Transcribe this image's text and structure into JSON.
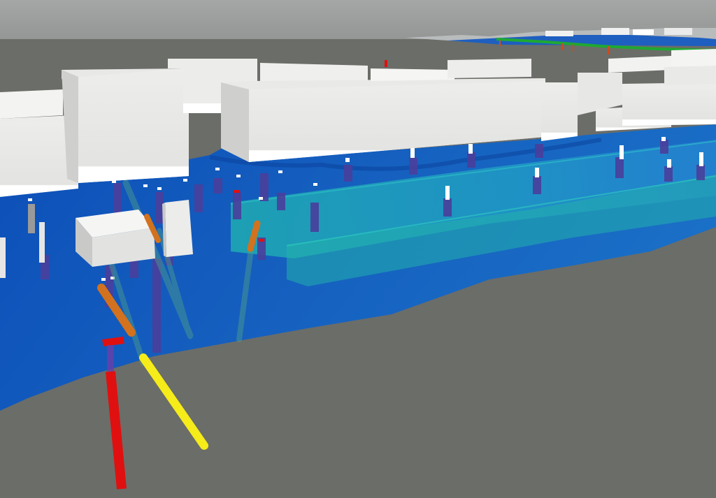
{
  "scene": {
    "kind": "3d-subsurface-visualization",
    "objects": [
      "buildings",
      "groundwater-surface",
      "boreholes",
      "tunnel-volume",
      "pipeline"
    ]
  },
  "colors": {
    "sky": "#9fa2a0",
    "ground": "#6b6d68",
    "building_top": "#ececea",
    "building_side": "#d8d8d6",
    "building_base": "#ffffff",
    "water_deep": "#0d4fb5",
    "water_mid": "#1f78c8",
    "water_cyan": "#22a7b8",
    "borehole_purple": "#4a3f9c",
    "borehole_red": "#e01010",
    "borehole_yellow": "#f5ec1a",
    "borehole_orange": "#d2721e",
    "borehole_grey": "#c8c8c8",
    "pipeline_green": "#1fa832"
  }
}
